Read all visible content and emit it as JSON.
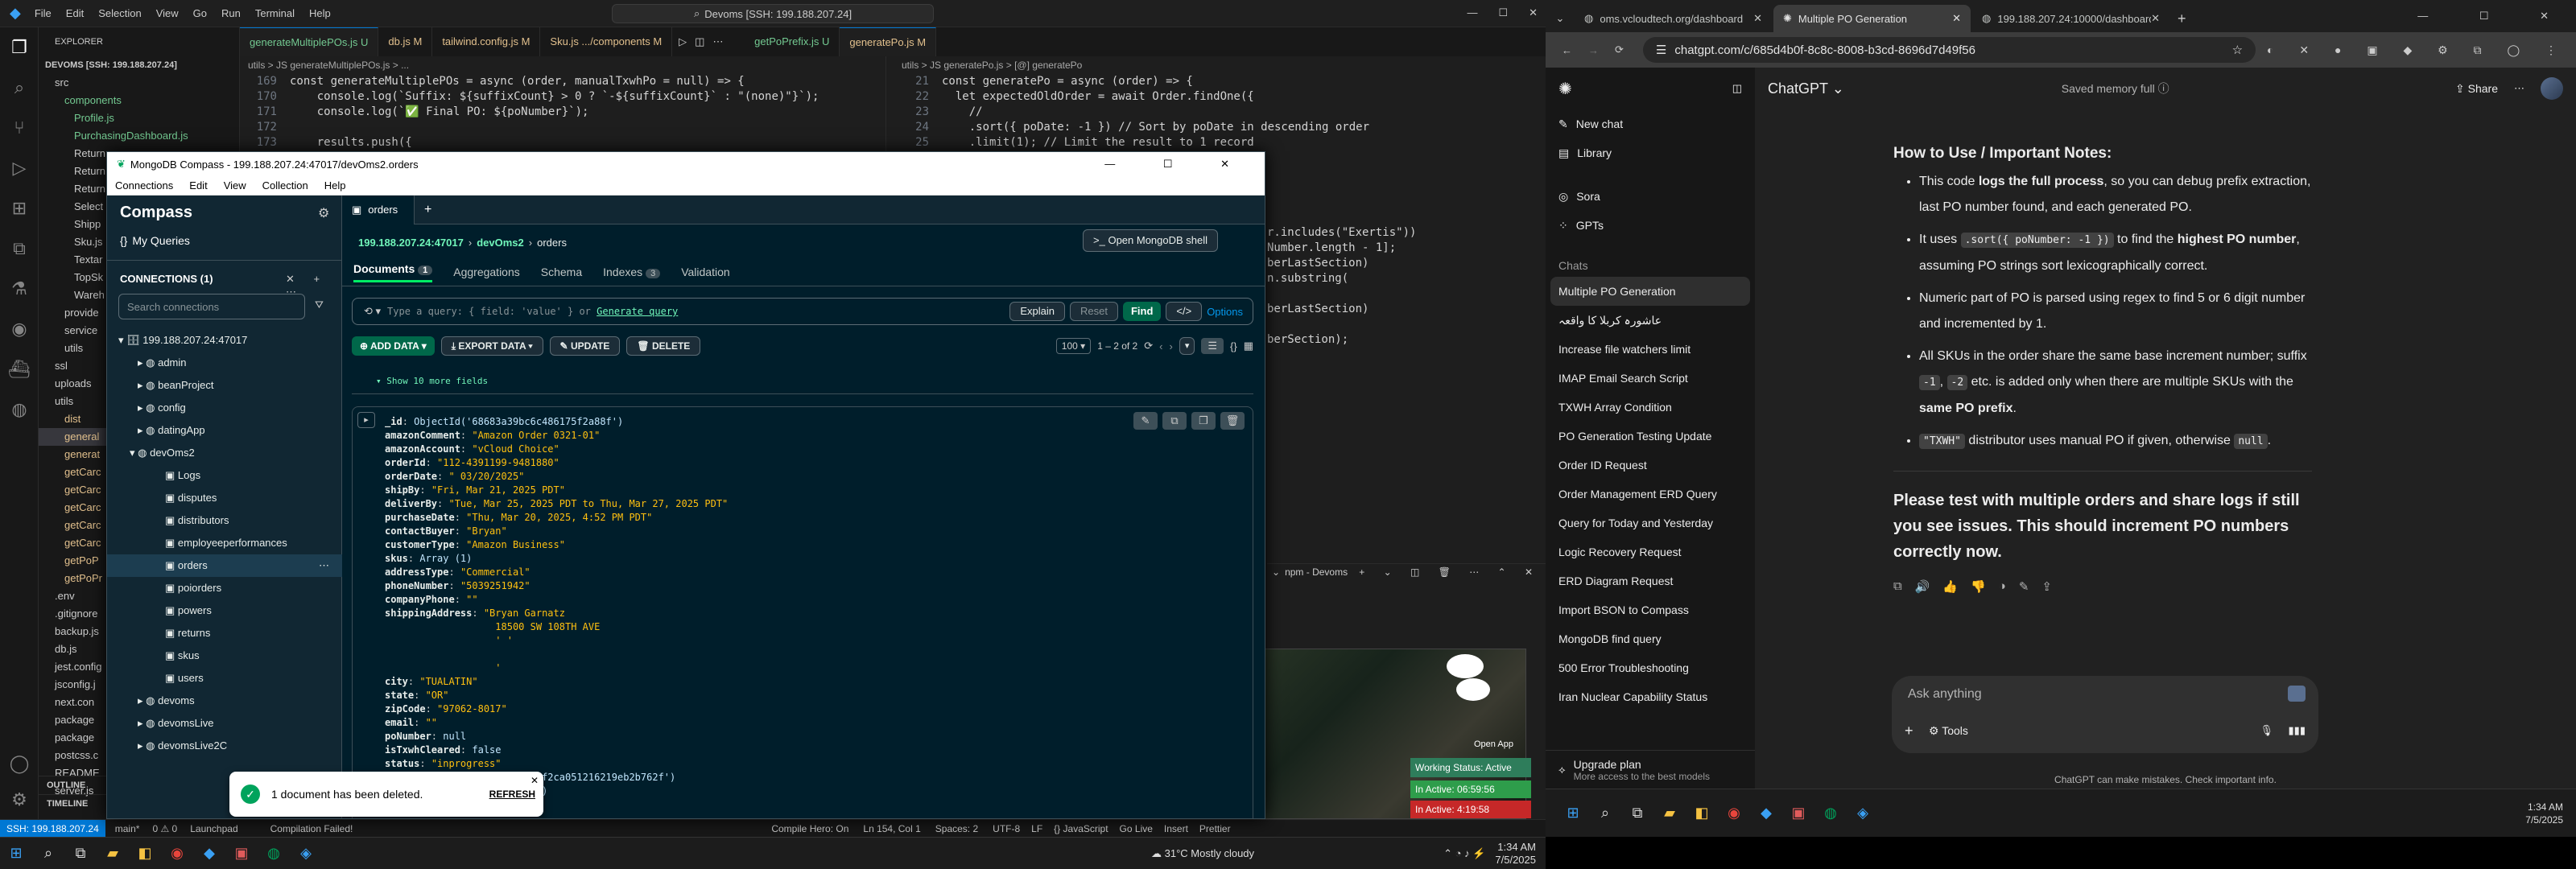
{
  "vscode": {
    "title": "Devoms [SSH: 199.188.207.24]",
    "menu": [
      "File",
      "Edit",
      "Selection",
      "View",
      "Go",
      "Run",
      "Terminal",
      "Help"
    ],
    "explorer_title": "EXPLORER",
    "workspace": "DEVOMS [SSH: 199.188.207.24]",
    "tree": [
      "src",
      "components",
      "Profile.js",
      "PurchasingDashboard.js",
      "Return",
      "Return",
      "Return",
      "Select",
      "Shipp",
      "Sku.js",
      "Textar",
      "TopSk",
      "Wareh",
      "provide",
      "service",
      "utils",
      "ssl",
      "uploads",
      "utils",
      "dist",
      "general",
      "generat",
      "getCarc",
      "getCarc",
      "getCarc",
      "getCarc",
      "getCarc",
      "getPoP",
      "getPoPr",
      ".env",
      ".gitignore",
      "backup.js",
      "db.js",
      "jest.config",
      "jsconfig.j",
      "next.con",
      "package",
      "package",
      "postcss.c",
      "README",
      "server.js"
    ],
    "outline": "OUTLINE",
    "timeline": "TIMELINE",
    "tabs": [
      "generateMultiplePOs.js  U",
      "db.js  M",
      "tailwind.config.js  M",
      "Sku.js .../components  M",
      "getPoPrefix.js  U",
      "generatePo.js  M"
    ],
    "breadcrumb_left": "utils > JS generateMultiplePOs.js > ...",
    "breadcrumb_right": "utils > JS generatePo.js > [@] generatePo",
    "left_code": [
      [
        "169",
        "const generateMultiplePOs = async (order, manualTxwhPo = null) => {"
      ],
      [
        "170",
        "    console.log(`Suffix: ${suffixCount} > 0 ? `-${suffixCount}` : \"(none)\"}`);"
      ],
      [
        "171",
        "    console.log(`✅ Final PO: ${poNumber}`);"
      ],
      [
        "172",
        ""
      ],
      [
        "173",
        "    results.push({"
      ]
    ],
    "right_code": [
      [
        "21",
        "const generatePo = async (order) => {"
      ],
      [
        "22",
        "  let expectedOldOrder = await Order.findOne({"
      ],
      [
        "23",
        "    //"
      ],
      [
        "24",
        "    .sort({ poDate: -1 }) // Sort by poDate in descending order"
      ],
      [
        "25",
        "    .limit(1); // Limit the result to 1 record"
      ]
    ],
    "right_code_mid": [
      "r.includes(\"Exertis\"))",
      "Number.length - 1];",
      "berLastSection)",
      "n.substring(",
      "",
      "berLastSection)",
      "",
      "berSection);"
    ],
    "terminal_bar": "npm - Devoms",
    "status": [
      "SSH: 199.188.207.24",
      "main*",
      "0 ⚠ 0",
      "Launchpad",
      "Compilation Failed!",
      "Compile Hero: On",
      "Ln 154, Col 1",
      "Spaces: 2",
      "UTF-8",
      "LF",
      "{} JavaScript",
      "Go Live",
      "Insert",
      "Prettier"
    ],
    "weather": "31°C  Mostly cloudy",
    "clock_time": "1:34 AM",
    "clock_date": "7/5/2025"
  },
  "compass": {
    "title": "MongoDB Compass - 199.188.207.24:47017/devOms2.orders",
    "menu": [
      "Connections",
      "Edit",
      "View",
      "Collection",
      "Help"
    ],
    "app_name": "Compass",
    "my_queries": "My Queries",
    "connections_label": "CONNECTIONS (1)",
    "search_placeholder": "Search connections",
    "host": "199.188.207.24:47017",
    "dbs": [
      "admin",
      "beanProject",
      "config",
      "datingApp"
    ],
    "open_db": "devOms2",
    "collections": [
      "Logs",
      "disputes",
      "distributors",
      "employeeperformances",
      "orders",
      "poiorders",
      "powers",
      "returns",
      "skus",
      "users"
    ],
    "dbs_after": [
      "devoms",
      "devomsLive",
      "devomsLive2C"
    ],
    "tab_label": "orders",
    "bc_host": "199.188.207.24:47017",
    "bc_db": "devOms2",
    "bc_coll": "orders",
    "shell_btn": "Open MongoDB shell",
    "subtabs": [
      "Documents",
      "Aggregations",
      "Schema",
      "Indexes",
      "Validation"
    ],
    "docs_count": "1",
    "indexes_count": "3",
    "query_placeholder": "Type a query: { field: 'value' } or",
    "generate_query": "Generate query",
    "explain": "Explain",
    "reset": "Reset",
    "find": "Find",
    "options": "Options",
    "add_data": "ADD DATA",
    "export_data": "EXPORT DATA",
    "update": "UPDATE",
    "delete": "DELETE",
    "page_size": "100",
    "page_range": "1 – 2 of 2",
    "show_more": "Show 10 more fields",
    "doc_lines": [
      [
        "_id",
        ": ",
        "ObjectId('68683a39bc6c486175f2a88f')",
        "o"
      ],
      [
        "amazonComment",
        ": ",
        "\"Amazon Order 0321-01\"",
        "s"
      ],
      [
        "amazonAccount",
        ": ",
        "\"vCloud Choice\"",
        "s"
      ],
      [
        "orderId",
        ": ",
        "\"112-4391199-9481880\"",
        "s"
      ],
      [
        "orderDate",
        ": ",
        "\" 03/20/2025\"",
        "s"
      ],
      [
        "shipBy",
        ": ",
        "\"Fri, Mar 21, 2025 PDT\"",
        "s"
      ],
      [
        "deliverBy",
        ": ",
        "\"Tue, Mar 25, 2025 PDT to Thu, Mar 27, 2025 PDT\"",
        "s"
      ],
      [
        "purchaseDate",
        ": ",
        "\"Thu, Mar 20, 2025, 4:52 PM PDT\"",
        "s"
      ],
      [
        "contactBuyer",
        ": ",
        "\"Bryan\"",
        "s"
      ],
      [
        "customerType",
        ": ",
        "\"Amazon Business\"",
        "s"
      ],
      [
        "skus",
        ": ",
        "Array (1)",
        "o"
      ],
      [
        "addressType",
        ": ",
        "\"Commercial\"",
        "s"
      ],
      [
        "phoneNumber",
        ": ",
        "\"5039251942\"",
        "s"
      ],
      [
        "companyPhone",
        ": ",
        "\"\"",
        "s"
      ],
      [
        "shippingAddress",
        ": ",
        "\"Bryan Garnatz",
        "s"
      ],
      [
        "",
        "",
        "                   18500 SW 108TH AVE",
        "s"
      ],
      [
        "",
        "",
        "                   ' '",
        "s"
      ],
      [
        "",
        "",
        "",
        ""
      ],
      [
        "",
        "",
        "                   '",
        "s"
      ],
      [
        "city",
        ": ",
        "\"TUALATIN\"",
        "s"
      ],
      [
        "state",
        ": ",
        "\"OR\"",
        "s"
      ],
      [
        "zipCode",
        ": ",
        "\"97062-8017\"",
        "s"
      ],
      [
        "email",
        ": ",
        "\"\"",
        "s"
      ],
      [
        "poNumber",
        ": ",
        "null",
        "o"
      ],
      [
        "isTxwhCleared",
        ": ",
        "false",
        "o"
      ],
      [
        "status",
        ": ",
        "\"inprogress\"",
        "s"
      ],
      [
        "createdBy_by",
        ": ",
        "ObjectId('674f2ca051216219eb2b762f')",
        "o"
      ],
      [
        "amazonAttachments",
        ": ",
        "Array (1)",
        "o"
      ]
    ],
    "toast": "1 document has been deleted.",
    "toast_action": "REFRESH"
  },
  "media": {
    "open_app": "Open App",
    "status1": "Working Status: Active",
    "status2": "In Active: 06:59:56",
    "status3": "In Active: 4:19:58"
  },
  "chrome": {
    "tabs": [
      "oms.vcloudtech.org/dashboard",
      "Multiple PO Generation",
      "199.188.207.24:10000/dashboard"
    ],
    "url": "chatgpt.com/c/685d4b0f-8c8c-8008-b3cd-8696d7d49f56",
    "gpt": {
      "new_chat": "New chat",
      "library": "Library",
      "sora": "Sora",
      "gpts": "GPTs",
      "chats_label": "Chats",
      "chats": [
        "Multiple PO Generation",
        "عاشورہ کربلا کا واقعہ",
        "Increase file watchers limit",
        "IMAP Email Search Script",
        "TXWH Array Condition",
        "PO Generation Testing Update",
        "Order ID Request",
        "Order Management ERD Query",
        "Query for Today and Yesterday",
        "Logic Recovery Request",
        "ERD Diagram Request",
        "Import BSON to Compass",
        "MongoDB find query",
        "500 Error Troubleshooting",
        "Iran Nuclear Capability Status"
      ],
      "upgrade": "Upgrade plan",
      "upgrade_sub": "More access to the best models",
      "model": "ChatGPT",
      "memory": "Saved memory full",
      "share": "Share",
      "heading": "How to Use / Important Notes:",
      "b1a": "This code ",
      "b1b": "logs the full process",
      "b1c": ", so you can debug prefix extraction, last PO number found, and each generated PO.",
      "b2a": "It uses ",
      "b2code": ".sort({ poNumber: -1 })",
      "b2b": " to find the ",
      "b2c": "highest PO number",
      "b2d": ", assuming PO strings sort lexicographically correct.",
      "b3": "Numeric part of PO is parsed using regex to find 5 or 6 digit number and incremented by 1.",
      "b4a": "All SKUs in the order share the same base increment number; suffix ",
      "b4c1": "-1",
      "b4b": ", ",
      "b4c2": "-2",
      "b4d": " etc. is added only when there are multiple SKUs with the ",
      "b4e": "same PO prefix",
      "b4f": ".",
      "b5code": "\"TXWH\"",
      "b5a": " distributor uses manual PO if given, otherwise ",
      "b5code2": "null",
      "b5b": ".",
      "bold_msg": "Please test with multiple orders and share logs if still you see issues. This should increment PO numbers correctly now.",
      "ask": "Ask anything",
      "tools": "Tools",
      "disclaimer": "ChatGPT can make mistakes. Check important info."
    },
    "clock_time": "1:34 AM",
    "clock_date": "7/5/2025"
  }
}
